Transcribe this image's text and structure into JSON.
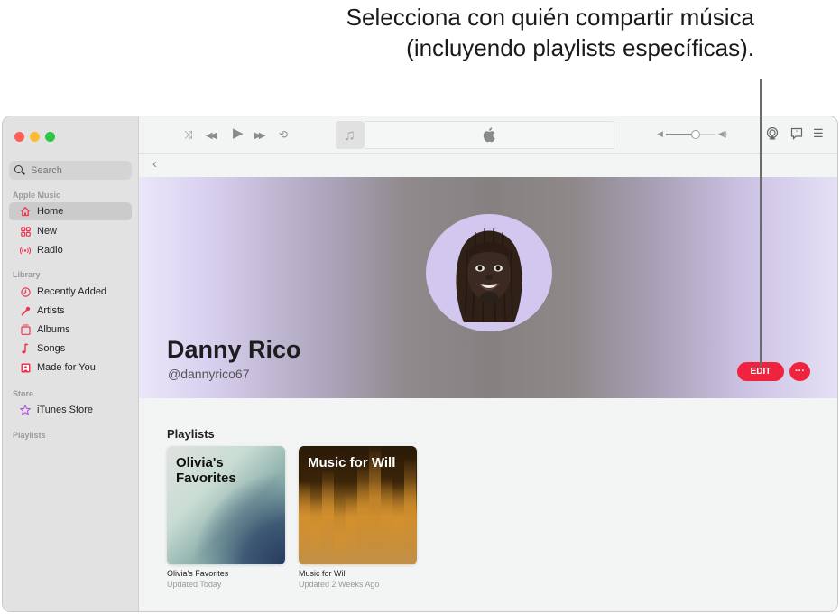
{
  "callout": {
    "text": "Selecciona con quién compartir música (incluyendo playlists específicas)."
  },
  "sidebar": {
    "search_placeholder": "Search",
    "sections": [
      {
        "title": "Apple Music",
        "items": [
          {
            "label": "Home",
            "icon": "home-icon",
            "active": true
          },
          {
            "label": "New",
            "icon": "grid-icon"
          },
          {
            "label": "Radio",
            "icon": "radio-icon"
          }
        ]
      },
      {
        "title": "Library",
        "items": [
          {
            "label": "Recently Added",
            "icon": "clock-icon"
          },
          {
            "label": "Artists",
            "icon": "microphone-icon"
          },
          {
            "label": "Albums",
            "icon": "album-icon"
          },
          {
            "label": "Songs",
            "icon": "music-note-icon"
          },
          {
            "label": "Made for You",
            "icon": "person-square-icon"
          }
        ]
      },
      {
        "title": "Store",
        "items": [
          {
            "label": "iTunes Store",
            "icon": "star-icon"
          }
        ]
      },
      {
        "title": "Playlists",
        "items": []
      }
    ]
  },
  "toolbar": {
    "icons": {
      "shuffle": "⤨",
      "previous": "◀◀",
      "play": "▶",
      "next": "▶▶",
      "repeat": "⟲",
      "note": "♫",
      "apple": "",
      "airplay": "airplay-icon",
      "lyrics": "lyrics-icon",
      "queue": "☰"
    },
    "volume": 0.6
  },
  "navigation": {
    "back": "‹"
  },
  "profile": {
    "name": "Danny Rico",
    "handle": "@dannyrico67",
    "edit_label": "EDIT",
    "more_label": "···"
  },
  "playlists": {
    "title": "Playlists",
    "items": [
      {
        "art_title": "Olivia's Favorites",
        "title": "Olivia's Favorites",
        "subtitle": "Updated Today"
      },
      {
        "art_title": "Music for Will",
        "title": "Music for Will",
        "subtitle": "Updated 2 Weeks Ago"
      }
    ]
  },
  "colors": {
    "accent": "#f0233e",
    "sidebar_bg": "#e2e2e2",
    "content_bg": "#f3f4f4"
  }
}
